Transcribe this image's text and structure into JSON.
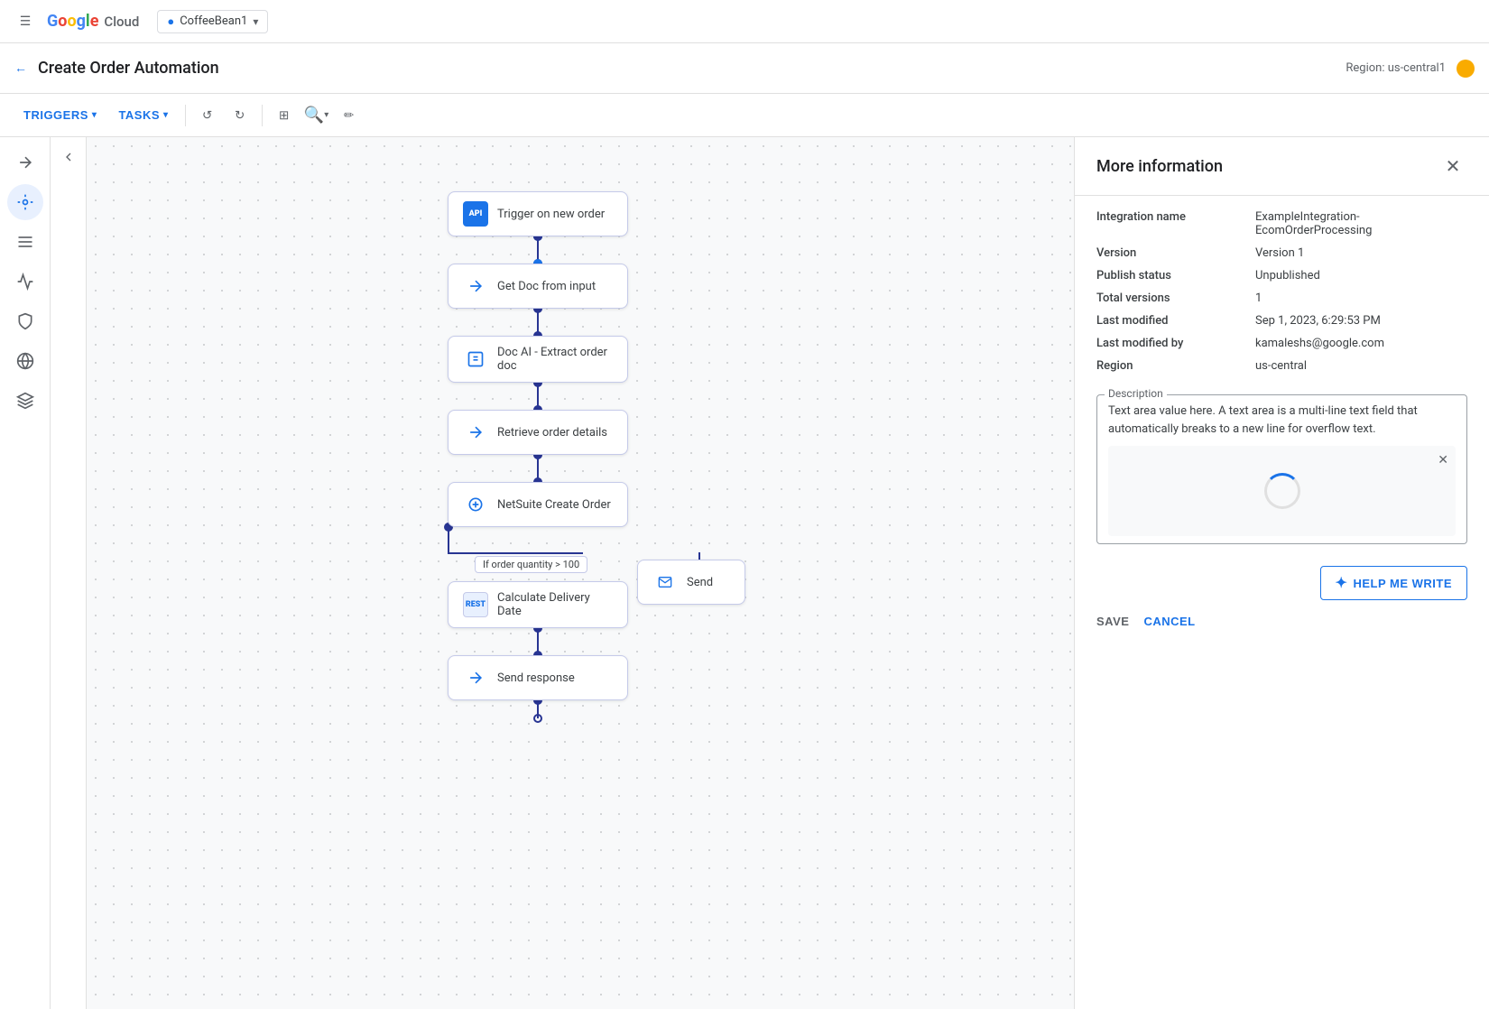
{
  "topbar": {
    "menu_icon": "☰",
    "logo_letters": [
      {
        "char": "G",
        "color": "g-blue"
      },
      {
        "char": "o",
        "color": "g-red"
      },
      {
        "char": "o",
        "color": "g-yellow"
      },
      {
        "char": "g",
        "color": "g-blue"
      },
      {
        "char": "l",
        "color": "g-green"
      },
      {
        "char": "e",
        "color": "g-red"
      }
    ],
    "cloud_text": "Cloud",
    "project_name": "CoffeeBean1",
    "dropdown_icon": "▾"
  },
  "secondbar": {
    "back_icon": "←",
    "page_title": "Create Order Automation",
    "region_label": "Region: us-central1"
  },
  "toolbar": {
    "triggers_label": "TRIGGERS",
    "tasks_label": "TASKS",
    "undo_icon": "↺",
    "redo_icon": "↻",
    "layout_icon": "⊞",
    "zoom_icon": "⌕",
    "pen_icon": "✏"
  },
  "sidebar": {
    "icons": [
      "⇄",
      "≡",
      "📊",
      "🛡",
      "🌐",
      "♦"
    ]
  },
  "flow_nodes": [
    {
      "id": "trigger",
      "label": "Trigger on new order",
      "icon_text": "API",
      "icon_type": "api"
    },
    {
      "id": "get_doc",
      "label": "Get Doc from input",
      "icon_type": "arrow"
    },
    {
      "id": "doc_ai",
      "label": "Doc AI - Extract order doc",
      "icon_type": "doc"
    },
    {
      "id": "retrieve",
      "label": "Retrieve order details",
      "icon_type": "arrow"
    },
    {
      "id": "netsuite",
      "label": "NetSuite Create Order",
      "icon_type": "netsuite"
    },
    {
      "id": "calculate",
      "label": "Calculate Delivery Date",
      "icon_type": "rest"
    },
    {
      "id": "send_response",
      "label": "Send response",
      "icon_type": "arrow"
    }
  ],
  "branch_label": "If order quantity > 100",
  "send_partial_label": "Send",
  "panel": {
    "title": "More information",
    "close_icon": "✕",
    "fields": [
      {
        "label": "Integration name",
        "value": "ExampleIntegration-EcomOrderProcessing"
      },
      {
        "label": "Version",
        "value": "Version 1"
      },
      {
        "label": "Publish status",
        "value": "Unpublished"
      },
      {
        "label": "Total versions",
        "value": "1"
      },
      {
        "label": "Last modified",
        "value": "Sep 1, 2023, 6:29:53 PM"
      },
      {
        "label": "Last modified by",
        "value": "kamaleshs@google.com"
      },
      {
        "label": "Region",
        "value": "us-central"
      }
    ],
    "description_legend": "Description",
    "description_text": "Text area value here. A text area is a multi-line text field that automatically breaks to a new line for overflow text.",
    "loading_close_icon": "✕",
    "help_me_write_icon": "✦",
    "help_me_write_label": "HELP ME WRITE",
    "save_label": "SAVE",
    "cancel_label": "CANCEL"
  }
}
